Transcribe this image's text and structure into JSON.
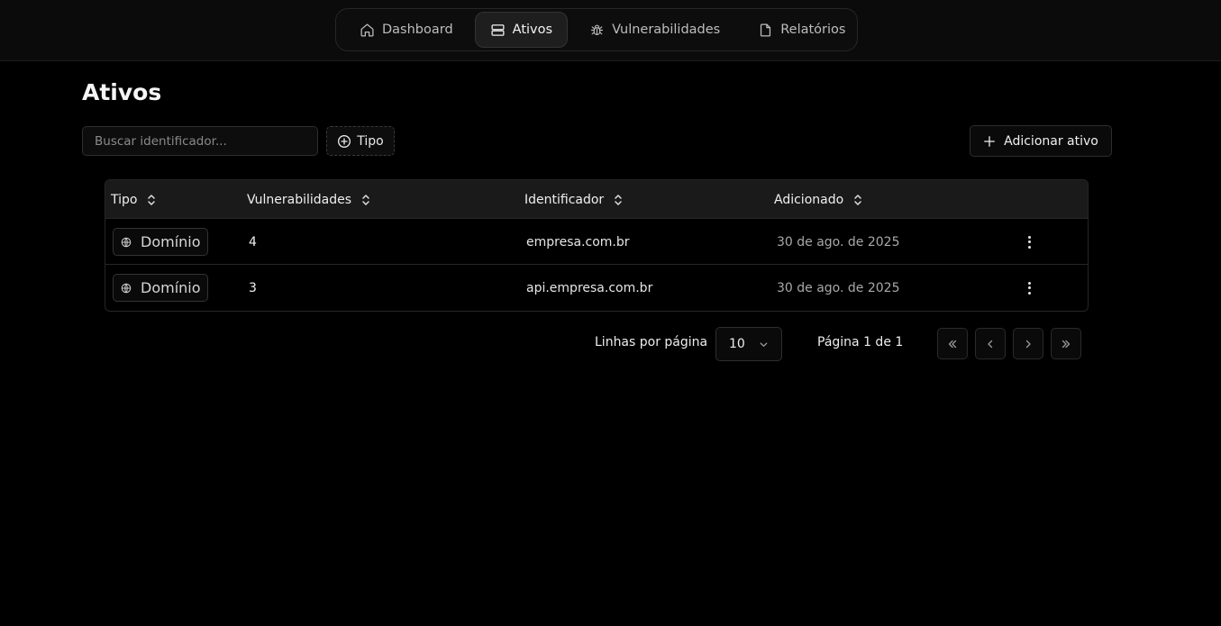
{
  "nav": {
    "items": [
      {
        "label": "Dashboard",
        "icon": "home-icon"
      },
      {
        "label": "Ativos",
        "icon": "server-icon",
        "active": true
      },
      {
        "label": "Vulnerabilidades",
        "icon": "bug-icon"
      },
      {
        "label": "Relatórios",
        "icon": "file-icon"
      }
    ]
  },
  "page": {
    "title": "Ativos"
  },
  "toolbar": {
    "search_placeholder": "Buscar identificador...",
    "search_value": "",
    "filter_label": "Tipo",
    "add_label": "Adicionar ativo"
  },
  "table": {
    "columns": [
      "Tipo",
      "Vulnerabilidades",
      "Identificador",
      "Adicionado"
    ],
    "rows": [
      {
        "tipo": "Domínio",
        "vulnerabilidades": "4",
        "identificador": "empresa.com.br",
        "adicionado": "30 de ago. de 2025"
      },
      {
        "tipo": "Domínio",
        "vulnerabilidades": "3",
        "identificador": "api.empresa.com.br",
        "adicionado": "30 de ago. de 2025"
      }
    ]
  },
  "pagination": {
    "rows_per_page_label": "Linhas por página",
    "rows_per_page_value": "10",
    "page_info": "Página 1 de 1"
  },
  "colors": {
    "background": "#000000",
    "header_row": "#1a1a1a",
    "border": "#262626"
  }
}
